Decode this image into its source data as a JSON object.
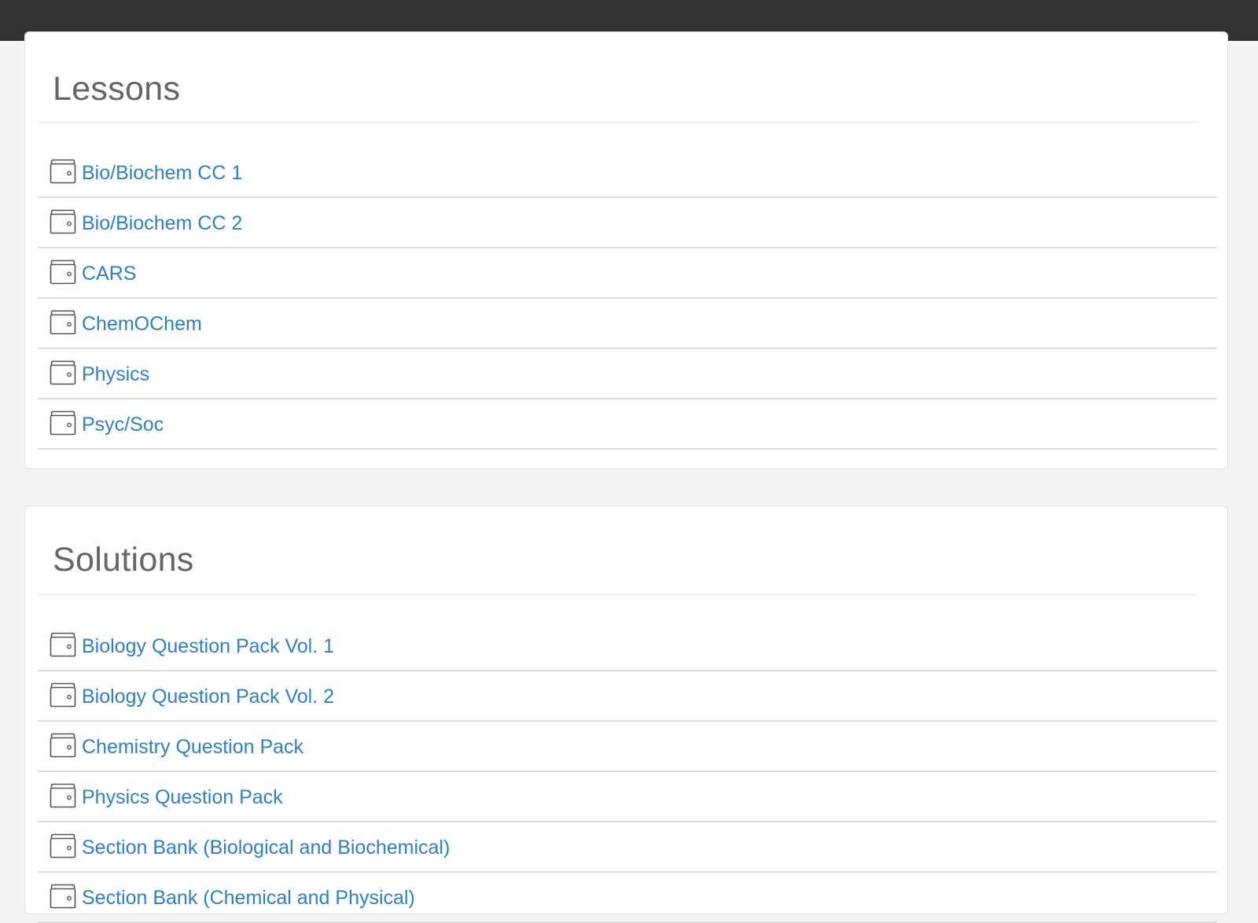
{
  "colors": {
    "topbar": "#333333",
    "page_background": "#f4f4f4",
    "panel_background": "#ffffff",
    "heading": "#666666",
    "link": "#2f80c8",
    "divider": "#dcdcdc"
  },
  "lessons": {
    "title": "Lessons",
    "items": [
      {
        "label": "Bio/Biochem CC 1",
        "icon": "folder-icon"
      },
      {
        "label": "Bio/Biochem CC 2",
        "icon": "folder-icon"
      },
      {
        "label": "CARS",
        "icon": "folder-icon"
      },
      {
        "label": "ChemOChem",
        "icon": "folder-icon"
      },
      {
        "label": "Physics",
        "icon": "folder-icon"
      },
      {
        "label": "Psyc/Soc",
        "icon": "folder-icon"
      }
    ]
  },
  "solutions": {
    "title": "Solutions",
    "items": [
      {
        "label": "Biology Question Pack Vol. 1",
        "icon": "folder-icon"
      },
      {
        "label": "Biology Question Pack Vol. 2",
        "icon": "folder-icon"
      },
      {
        "label": "Chemistry Question Pack",
        "icon": "folder-icon"
      },
      {
        "label": "Physics Question Pack",
        "icon": "folder-icon"
      },
      {
        "label": "Section Bank (Biological and Biochemical)",
        "icon": "folder-icon"
      },
      {
        "label": "Section Bank (Chemical and Physical)",
        "icon": "folder-icon"
      }
    ]
  }
}
